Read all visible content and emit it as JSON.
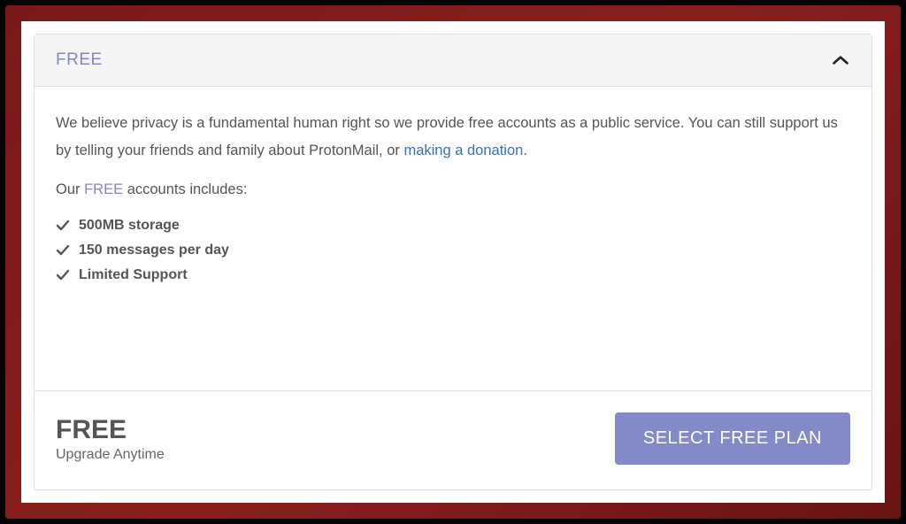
{
  "header": {
    "title": "FREE"
  },
  "body": {
    "intro_prefix": "We believe privacy is a fundamental human right so we provide free accounts as a public service. You can still support us by telling your friends and family about ProtonMail, or ",
    "donation_link_text": "making a donation",
    "intro_suffix": ".",
    "includes_prefix": "Our ",
    "includes_bold": "FREE",
    "includes_suffix": " accounts includes:",
    "features": [
      "500MB storage",
      "150 messages per day",
      "Limited Support"
    ]
  },
  "footer": {
    "plan_name": "FREE",
    "upgrade_text": "Upgrade Anytime",
    "button_label": "SELECT FREE PLAN"
  },
  "colors": {
    "accent": "#8489c8",
    "link": "#3b6fb6"
  }
}
